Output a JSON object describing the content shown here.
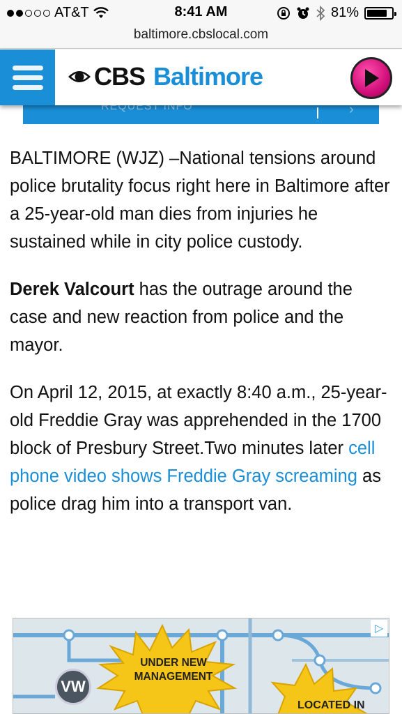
{
  "status_bar": {
    "carrier": "AT&T",
    "time": "8:41 AM",
    "battery_percent": "81%",
    "battery_level": 0.81,
    "signal_bars": 2,
    "icons": [
      "wifi-icon",
      "rotation-lock-icon",
      "alarm-icon",
      "bluetooth-icon",
      "battery-icon"
    ]
  },
  "url_bar": {
    "url": "baltimore.cbslocal.com"
  },
  "site_header": {
    "brand": "CBS",
    "city": "Baltimore",
    "colors": {
      "accent": "#1a8fd8",
      "play": "#d10f7a"
    }
  },
  "ribbon": {
    "text": "REQUEST INFO",
    "chevron": "›"
  },
  "article": {
    "p1": "BALTIMORE (WJZ) –National tensions around police brutality focus right here in Baltimore after a 25-year-old man dies from injuries he sustained while in city police custody.",
    "p2_bold": "Derek Valcourt",
    "p2_rest": " has the outrage around the case and new reaction from police and the mayor.",
    "p3_start": "On April 12, 2015, at exactly 8:40 a.m., 25-year-old Freddie Gray was apprehended in the 1700 block of Presbury Street.Two minutes later ",
    "p3_link": "cell phone video shows Freddie Gray screaming",
    "p3_end": " as police drag him into a transport van."
  },
  "ad": {
    "badge1": "UNDER NEW MANAGEMENT",
    "badge2": "LOCATED IN",
    "logo": "VW"
  }
}
